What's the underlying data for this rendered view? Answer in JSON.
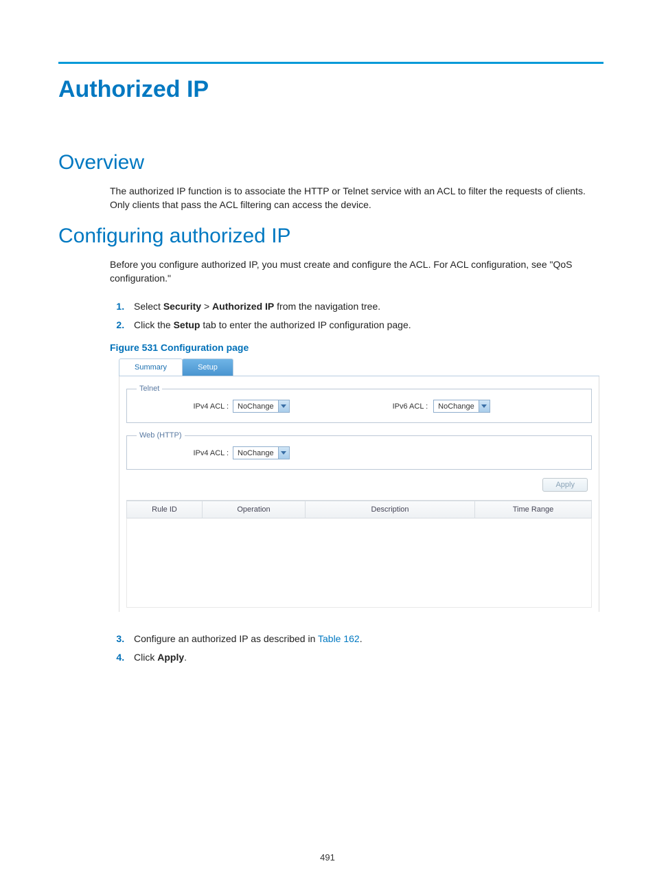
{
  "title": "Authorized IP",
  "overview": {
    "heading": "Overview",
    "text": "The authorized IP function is to associate the HTTP or Telnet service with an ACL to filter the requests of clients. Only clients that pass the ACL filtering can access the device."
  },
  "configure": {
    "heading": "Configuring authorized IP",
    "intro": "Before you configure authorized IP, you must create and configure the ACL. For ACL configuration, see \"QoS configuration.\"",
    "steps12": [
      {
        "pre": "Select ",
        "b1": "Security",
        "mid": " > ",
        "b2": "Authorized IP",
        "post": " from the navigation tree."
      },
      {
        "pre": "Click the ",
        "b1": "Setup",
        "post": " tab to enter the authorized IP configuration page."
      }
    ],
    "figure_caption": "Figure 531 Configuration page",
    "steps34": [
      {
        "pre": "Configure an authorized IP as described in ",
        "link": "Table 162",
        "post": "."
      },
      {
        "pre": "Click ",
        "b1": "Apply",
        "post": "."
      }
    ]
  },
  "figure": {
    "tabs": {
      "summary": "Summary",
      "setup": "Setup"
    },
    "telnet": {
      "legend": "Telnet",
      "ipv4_label": "IPv4 ACL :",
      "ipv4_value": "NoChange",
      "ipv6_label": "IPv6 ACL :",
      "ipv6_value": "NoChange"
    },
    "web": {
      "legend": "Web (HTTP)",
      "ipv4_label": "IPv4 ACL :",
      "ipv4_value": "NoChange"
    },
    "apply": "Apply",
    "table_headers": {
      "rule": "Rule ID",
      "op": "Operation",
      "desc": "Description",
      "time": "Time Range"
    }
  },
  "page_number": "491"
}
